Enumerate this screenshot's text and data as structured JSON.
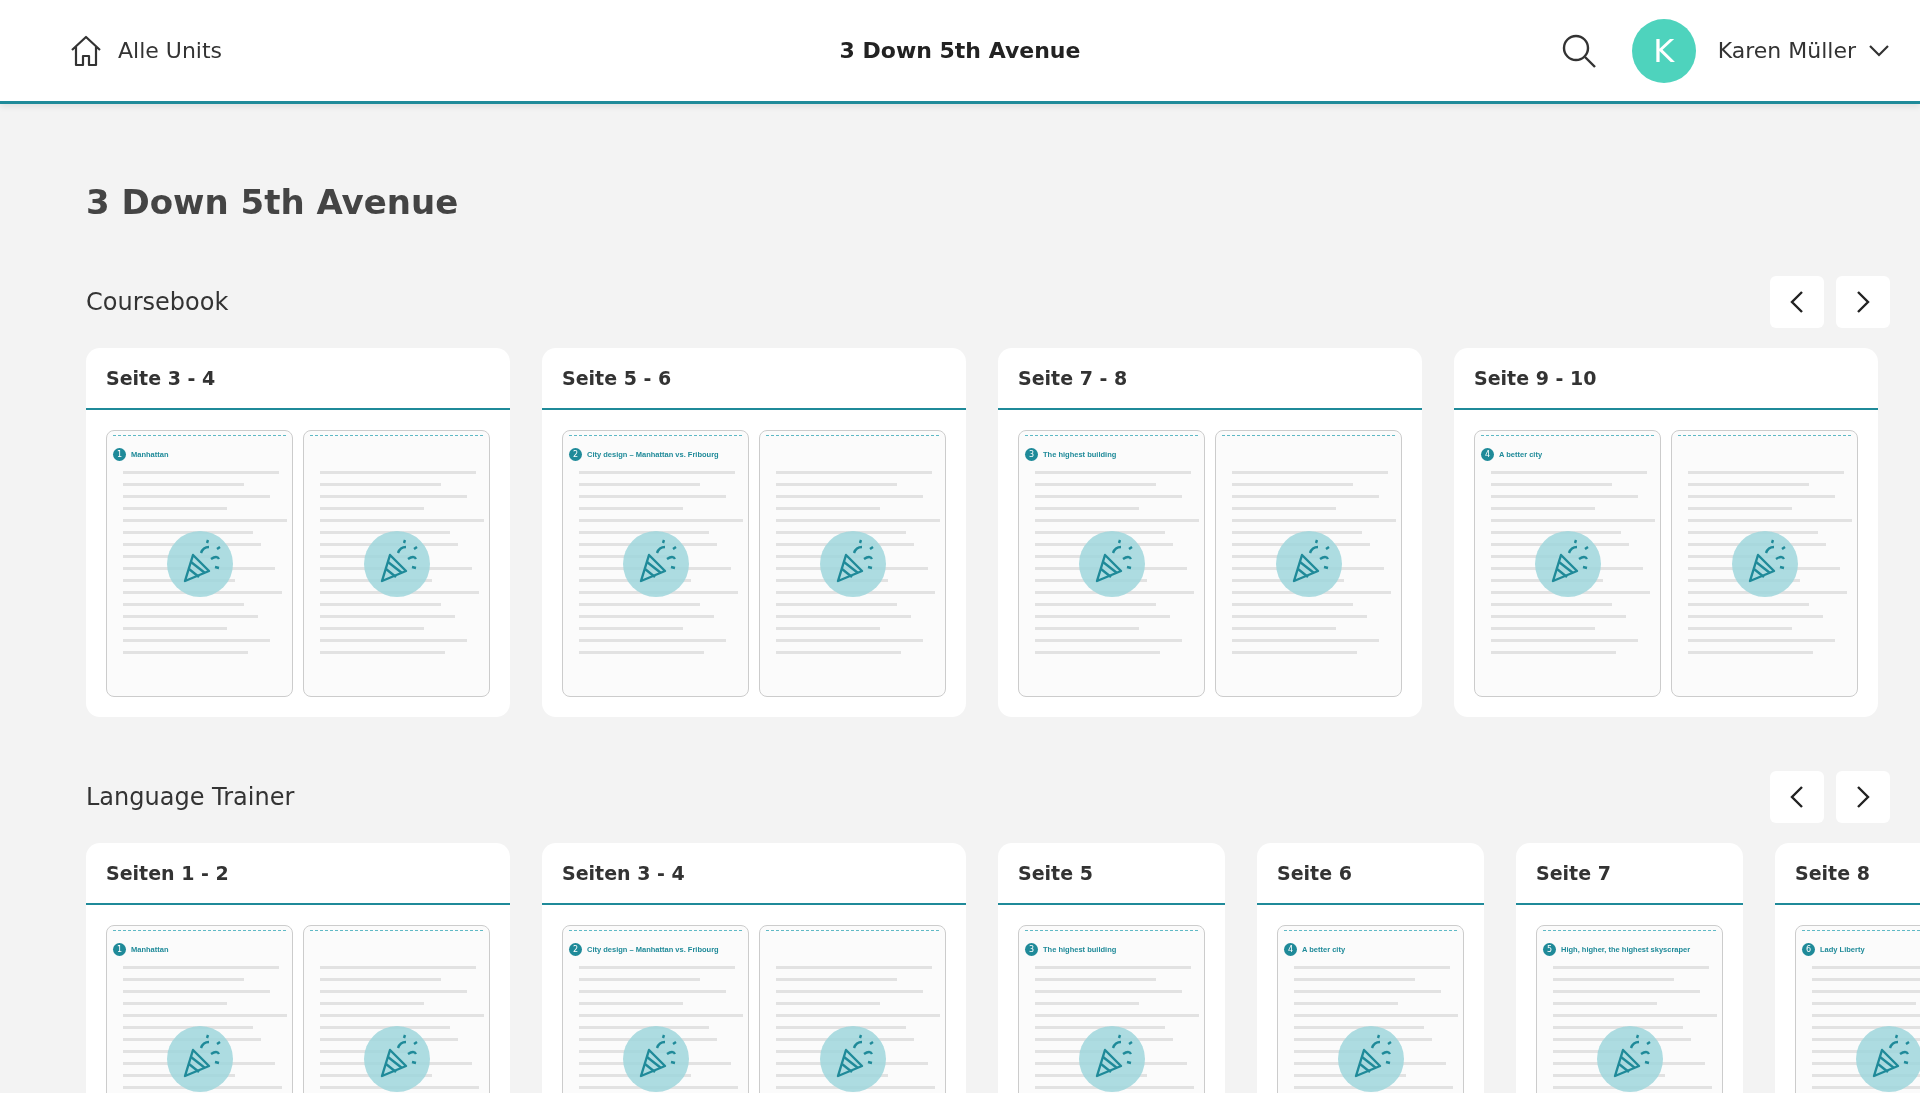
{
  "header": {
    "home_label": "Alle Units",
    "title": "3 Down 5th Avenue",
    "avatar_initial": "K",
    "user_name": "Karen Müller"
  },
  "page_title": "3 Down 5th Avenue",
  "sections": [
    {
      "title": "Coursebook",
      "cards": [
        {
          "label": "Seite 3 - 4",
          "pages": [
            {
              "kind": "opener",
              "number": "1",
              "heading": "Manhattan"
            },
            {
              "kind": "plain"
            }
          ]
        },
        {
          "label": "Seite 5 - 6",
          "pages": [
            {
              "kind": "opener",
              "number": "2",
              "heading": "City design – Manhattan vs. Fribourg"
            },
            {
              "kind": "plain"
            }
          ]
        },
        {
          "label": "Seite 7 - 8",
          "pages": [
            {
              "kind": "opener",
              "number": "3",
              "heading": "The highest building"
            },
            {
              "kind": "plain"
            }
          ]
        },
        {
          "label": "Seite 9 - 10",
          "pages": [
            {
              "kind": "opener",
              "number": "4",
              "heading": "A better city"
            },
            {
              "kind": "plain"
            }
          ]
        }
      ]
    },
    {
      "title": "Language Trainer",
      "cards": [
        {
          "label": "Seiten 1 - 2",
          "pages": [
            {
              "kind": "opener",
              "number": "1",
              "heading": "Manhattan"
            },
            {
              "kind": "plain"
            }
          ]
        },
        {
          "label": "Seiten 3 - 4",
          "pages": [
            {
              "kind": "opener",
              "number": "2",
              "heading": "City design – Manhattan vs. Fribourg"
            },
            {
              "kind": "plain"
            }
          ]
        },
        {
          "label": "Seite 5",
          "pages": [
            {
              "kind": "opener",
              "number": "3",
              "heading": "The highest building"
            }
          ]
        },
        {
          "label": "Seite 6",
          "pages": [
            {
              "kind": "opener",
              "number": "4",
              "heading": "A better city"
            }
          ]
        },
        {
          "label": "Seite 7",
          "pages": [
            {
              "kind": "opener",
              "number": "5",
              "heading": "High, higher, the highest skyscraper"
            }
          ]
        },
        {
          "label": "Seite 8",
          "pages": [
            {
              "kind": "opener",
              "number": "6",
              "heading": "Lady Liberty"
            }
          ]
        }
      ]
    }
  ]
}
